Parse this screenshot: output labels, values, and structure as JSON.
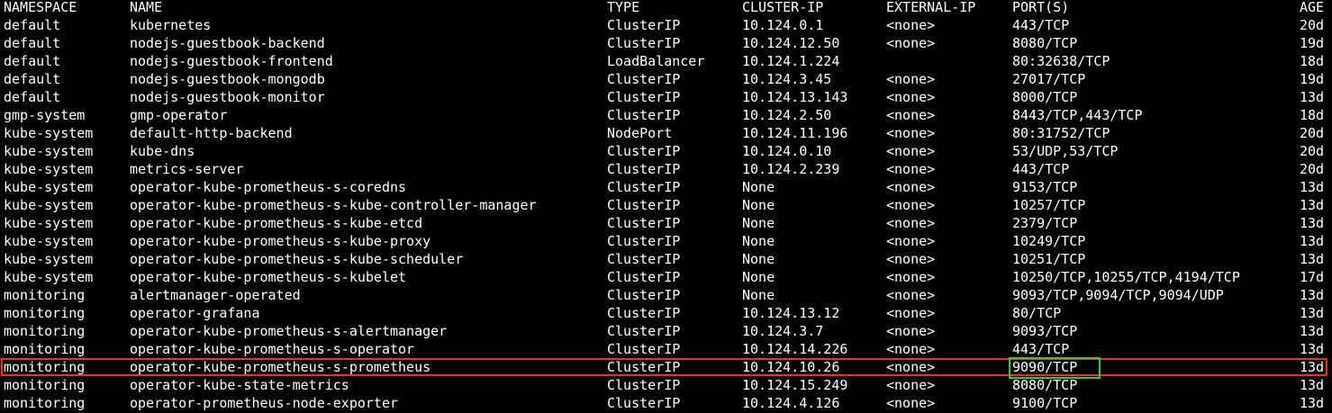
{
  "headers": {
    "namespace": "NAMESPACE",
    "name": "NAME",
    "type": "TYPE",
    "cluster_ip": "CLUSTER-IP",
    "external_ip": "EXTERNAL-IP",
    "ports": "PORT(S)",
    "age": "AGE"
  },
  "rows": [
    {
      "namespace": "default",
      "name": "kubernetes",
      "type": "ClusterIP",
      "cluster_ip": "10.124.0.1",
      "external_ip": "<none>",
      "ports": "443/TCP",
      "age": "20d"
    },
    {
      "namespace": "default",
      "name": "nodejs-guestbook-backend",
      "type": "ClusterIP",
      "cluster_ip": "10.124.12.50",
      "external_ip": "<none>",
      "ports": "8080/TCP",
      "age": "19d"
    },
    {
      "namespace": "default",
      "name": "nodejs-guestbook-frontend",
      "type": "LoadBalancer",
      "cluster_ip": "10.124.1.224",
      "external_ip": "",
      "ports": "80:32638/TCP",
      "age": "18d"
    },
    {
      "namespace": "default",
      "name": "nodejs-guestbook-mongodb",
      "type": "ClusterIP",
      "cluster_ip": "10.124.3.45",
      "external_ip": "<none>",
      "ports": "27017/TCP",
      "age": "19d"
    },
    {
      "namespace": "default",
      "name": "nodejs-guestbook-monitor",
      "type": "ClusterIP",
      "cluster_ip": "10.124.13.143",
      "external_ip": "<none>",
      "ports": "8000/TCP",
      "age": "13d"
    },
    {
      "namespace": "gmp-system",
      "name": "gmp-operator",
      "type": "ClusterIP",
      "cluster_ip": "10.124.2.50",
      "external_ip": "<none>",
      "ports": "8443/TCP,443/TCP",
      "age": "18d"
    },
    {
      "namespace": "kube-system",
      "name": "default-http-backend",
      "type": "NodePort",
      "cluster_ip": "10.124.11.196",
      "external_ip": "<none>",
      "ports": "80:31752/TCP",
      "age": "20d"
    },
    {
      "namespace": "kube-system",
      "name": "kube-dns",
      "type": "ClusterIP",
      "cluster_ip": "10.124.0.10",
      "external_ip": "<none>",
      "ports": "53/UDP,53/TCP",
      "age": "20d"
    },
    {
      "namespace": "kube-system",
      "name": "metrics-server",
      "type": "ClusterIP",
      "cluster_ip": "10.124.2.239",
      "external_ip": "<none>",
      "ports": "443/TCP",
      "age": "20d"
    },
    {
      "namespace": "kube-system",
      "name": "operator-kube-prometheus-s-coredns",
      "type": "ClusterIP",
      "cluster_ip": "None",
      "external_ip": "<none>",
      "ports": "9153/TCP",
      "age": "13d"
    },
    {
      "namespace": "kube-system",
      "name": "operator-kube-prometheus-s-kube-controller-manager",
      "type": "ClusterIP",
      "cluster_ip": "None",
      "external_ip": "<none>",
      "ports": "10257/TCP",
      "age": "13d"
    },
    {
      "namespace": "kube-system",
      "name": "operator-kube-prometheus-s-kube-etcd",
      "type": "ClusterIP",
      "cluster_ip": "None",
      "external_ip": "<none>",
      "ports": "2379/TCP",
      "age": "13d"
    },
    {
      "namespace": "kube-system",
      "name": "operator-kube-prometheus-s-kube-proxy",
      "type": "ClusterIP",
      "cluster_ip": "None",
      "external_ip": "<none>",
      "ports": "10249/TCP",
      "age": "13d"
    },
    {
      "namespace": "kube-system",
      "name": "operator-kube-prometheus-s-kube-scheduler",
      "type": "ClusterIP",
      "cluster_ip": "None",
      "external_ip": "<none>",
      "ports": "10251/TCP",
      "age": "13d"
    },
    {
      "namespace": "kube-system",
      "name": "operator-kube-prometheus-s-kubelet",
      "type": "ClusterIP",
      "cluster_ip": "None",
      "external_ip": "<none>",
      "ports": "10250/TCP,10255/TCP,4194/TCP",
      "age": "17d"
    },
    {
      "namespace": "monitoring",
      "name": "alertmanager-operated",
      "type": "ClusterIP",
      "cluster_ip": "None",
      "external_ip": "<none>",
      "ports": "9093/TCP,9094/TCP,9094/UDP",
      "age": "13d"
    },
    {
      "namespace": "monitoring",
      "name": "operator-grafana",
      "type": "ClusterIP",
      "cluster_ip": "10.124.13.12",
      "external_ip": "<none>",
      "ports": "80/TCP",
      "age": "13d"
    },
    {
      "namespace": "monitoring",
      "name": "operator-kube-prometheus-s-alertmanager",
      "type": "ClusterIP",
      "cluster_ip": "10.124.3.7",
      "external_ip": "<none>",
      "ports": "9093/TCP",
      "age": "13d"
    },
    {
      "namespace": "monitoring",
      "name": "operator-kube-prometheus-s-operator",
      "type": "ClusterIP",
      "cluster_ip": "10.124.14.226",
      "external_ip": "<none>",
      "ports": "443/TCP",
      "age": "13d"
    },
    {
      "namespace": "monitoring",
      "name": "operator-kube-prometheus-s-prometheus",
      "type": "ClusterIP",
      "cluster_ip": "10.124.10.26",
      "external_ip": "<none>",
      "ports": "9090/TCP",
      "age": "13d"
    },
    {
      "namespace": "monitoring",
      "name": "operator-kube-state-metrics",
      "type": "ClusterIP",
      "cluster_ip": "10.124.15.249",
      "external_ip": "<none>",
      "ports": "8080/TCP",
      "age": "13d"
    },
    {
      "namespace": "monitoring",
      "name": "operator-prometheus-node-exporter",
      "type": "ClusterIP",
      "cluster_ip": "10.124.4.126",
      "external_ip": "<none>",
      "ports": "9100/TCP",
      "age": "13d"
    }
  ],
  "colors": {
    "background": "#000000",
    "text": "#ffffff",
    "row_highlight": "#e8341c",
    "port_highlight": "#2bd12b"
  }
}
